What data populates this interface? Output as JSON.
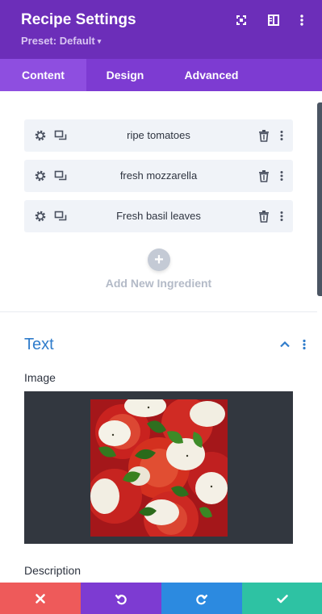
{
  "header": {
    "title": "Recipe Settings",
    "preset_label": "Preset: Default",
    "icons": [
      "expand-icon",
      "sidebar-toggle-icon",
      "more-options-icon"
    ]
  },
  "tabs": [
    {
      "label": "Content",
      "active": true
    },
    {
      "label": "Design",
      "active": false
    },
    {
      "label": "Advanced",
      "active": false
    }
  ],
  "ingredients": {
    "items": [
      {
        "label": "ripe tomatoes"
      },
      {
        "label": "fresh mozzarella"
      },
      {
        "label": "Fresh basil leaves"
      }
    ],
    "item_icons": [
      "gear-icon",
      "duplicate-icon",
      "trash-icon",
      "more-options-icon"
    ],
    "add_label": "Add New Ingredient"
  },
  "text_section": {
    "title": "Text",
    "image_label": "Image",
    "description_label": "Description"
  },
  "footer": {
    "buttons": [
      "cancel-icon",
      "undo-icon",
      "redo-icon",
      "save-check-icon"
    ]
  },
  "colors": {
    "header": "#6c2eb9",
    "tabs": "#7d3bd2",
    "accent_blue": "#2f7ccb",
    "cancel": "#ee5a5a",
    "undo": "#7d3bd2",
    "redo": "#2c8ae0",
    "save": "#2ec2a3"
  }
}
